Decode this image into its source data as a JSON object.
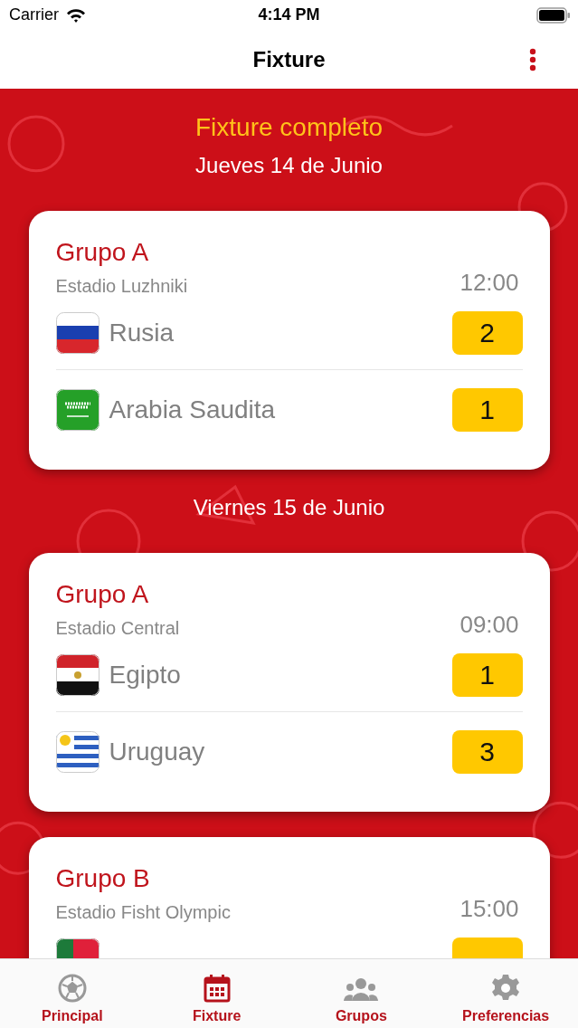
{
  "status_bar": {
    "carrier": "Carrier",
    "time": "4:14 PM"
  },
  "nav": {
    "title": "Fixture"
  },
  "heading": "Fixture completo",
  "days": [
    {
      "date": "Jueves 14 de Junio",
      "matches": [
        {
          "group": "Grupo A",
          "stadium": "Estadio Luzhniki",
          "time": "12:00",
          "teams": [
            {
              "kind": "russia",
              "name": "Rusia",
              "score": "2"
            },
            {
              "kind": "saudi",
              "name": "Arabia Saudita",
              "score": "1"
            }
          ]
        }
      ]
    },
    {
      "date": "Viernes 15 de Junio",
      "matches": [
        {
          "group": "Grupo A",
          "stadium": "Estadio Central",
          "time": "09:00",
          "teams": [
            {
              "kind": "egypt",
              "name": "Egipto",
              "score": "1"
            },
            {
              "kind": "uruguay",
              "name": "Uruguay",
              "score": "3"
            }
          ]
        },
        {
          "group": "Grupo B",
          "stadium": "Estadio Fisht Olympic",
          "time": "15:00",
          "teams": [
            {
              "kind": "portugal"
            }
          ]
        }
      ]
    }
  ],
  "tabs": [
    {
      "kind": "ball",
      "label": "Principal",
      "selected": false
    },
    {
      "kind": "calendar",
      "label": "Fixture",
      "selected": true
    },
    {
      "kind": "people",
      "label": "Grupos",
      "selected": false
    },
    {
      "kind": "gear",
      "label": "Preferencias",
      "selected": false
    }
  ]
}
